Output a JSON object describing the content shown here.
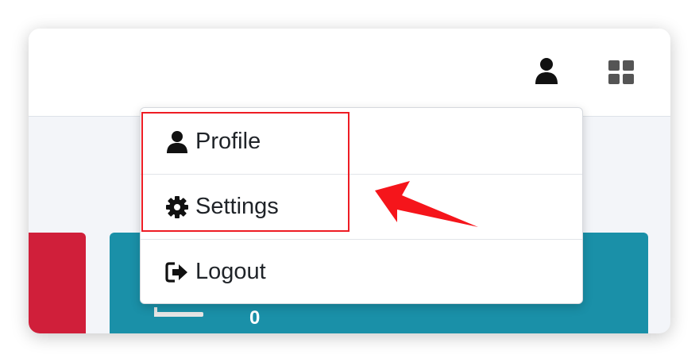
{
  "header": {
    "user_icon": "user-icon",
    "grid_icon": "grid-icon"
  },
  "dashboard": {
    "teal_card": {
      "value": "0",
      "icon": "card-icon"
    }
  },
  "user_menu": {
    "items": [
      {
        "label": "Profile",
        "icon": "user-icon"
      },
      {
        "label": "Settings",
        "icon": "gear-icon"
      },
      {
        "label": "Logout",
        "icon": "logout-icon"
      }
    ]
  },
  "colors": {
    "red_card": "#d01f3a",
    "teal_card": "#1a90a8",
    "annotation": "#ee1c24",
    "topbar": "#ffffff",
    "page_bg": "#f3f5f9"
  }
}
